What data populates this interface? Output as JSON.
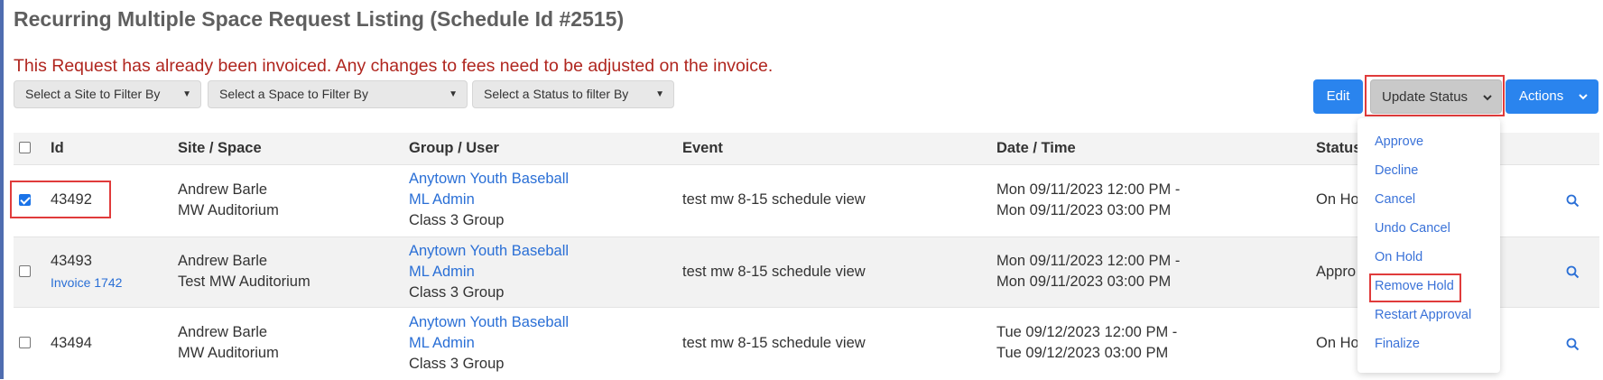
{
  "page": {
    "title": "Recurring Multiple Space Request Listing (Schedule Id #2515)",
    "warning": "This Request has already been invoiced. Any changes to fees need to be adjusted on the invoice."
  },
  "filters": {
    "site": "Select a Site to Filter By",
    "space": "Select a Space to Filter By",
    "status": "Select a Status to filter By"
  },
  "toolbar": {
    "edit": "Edit",
    "update_status": "Update Status",
    "actions": "Actions"
  },
  "status_menu": {
    "items": [
      "Approve",
      "Decline",
      "Cancel",
      "Undo Cancel",
      "On Hold",
      "Remove Hold",
      "Restart Approval",
      "Finalize"
    ]
  },
  "table": {
    "headers": {
      "id": "Id",
      "site_space": "Site / Space",
      "group_user": "Group / User",
      "event": "Event",
      "date_time": "Date / Time",
      "status": "Status"
    },
    "rows": [
      {
        "checked": true,
        "id": "43492",
        "invoice": "",
        "site": "Andrew Barle",
        "space": "MW Auditorium",
        "group": "Anytown Youth Baseball",
        "user": "ML Admin",
        "class": "Class 3 Group",
        "event": "test mw 8-15 schedule view",
        "start": "Mon 09/11/2023 12:00 PM -",
        "end": "Mon 09/11/2023 03:00 PM",
        "status": "On Ho"
      },
      {
        "checked": false,
        "id": "43493",
        "invoice": "Invoice 1742",
        "site": "Andrew Barle",
        "space": "Test MW Auditorium",
        "group": "Anytown Youth Baseball",
        "user": "ML Admin",
        "class": "Class 3 Group",
        "event": "test mw 8-15 schedule view",
        "start": "Mon 09/11/2023 12:00 PM -",
        "end": "Mon 09/11/2023 03:00 PM",
        "status": "Appro"
      },
      {
        "checked": false,
        "id": "43494",
        "invoice": "",
        "site": "Andrew Barle",
        "space": "MW Auditorium",
        "group": "Anytown Youth Baseball",
        "user": "ML Admin",
        "class": "Class 3 Group",
        "event": "test mw 8-15 schedule view",
        "start": "Tue 09/12/2023 12:00 PM -",
        "end": "Tue 09/12/2023 03:00 PM",
        "status": "On Ho"
      }
    ]
  },
  "icons": {
    "row_action": "magnifier-icon",
    "dropdown_caret": "chevron-down-icon"
  },
  "colors": {
    "primary": "#2a84ee",
    "warning_text": "#b0261f",
    "link": "#2a6fd6",
    "highlight_outline": "#e03b3b"
  }
}
